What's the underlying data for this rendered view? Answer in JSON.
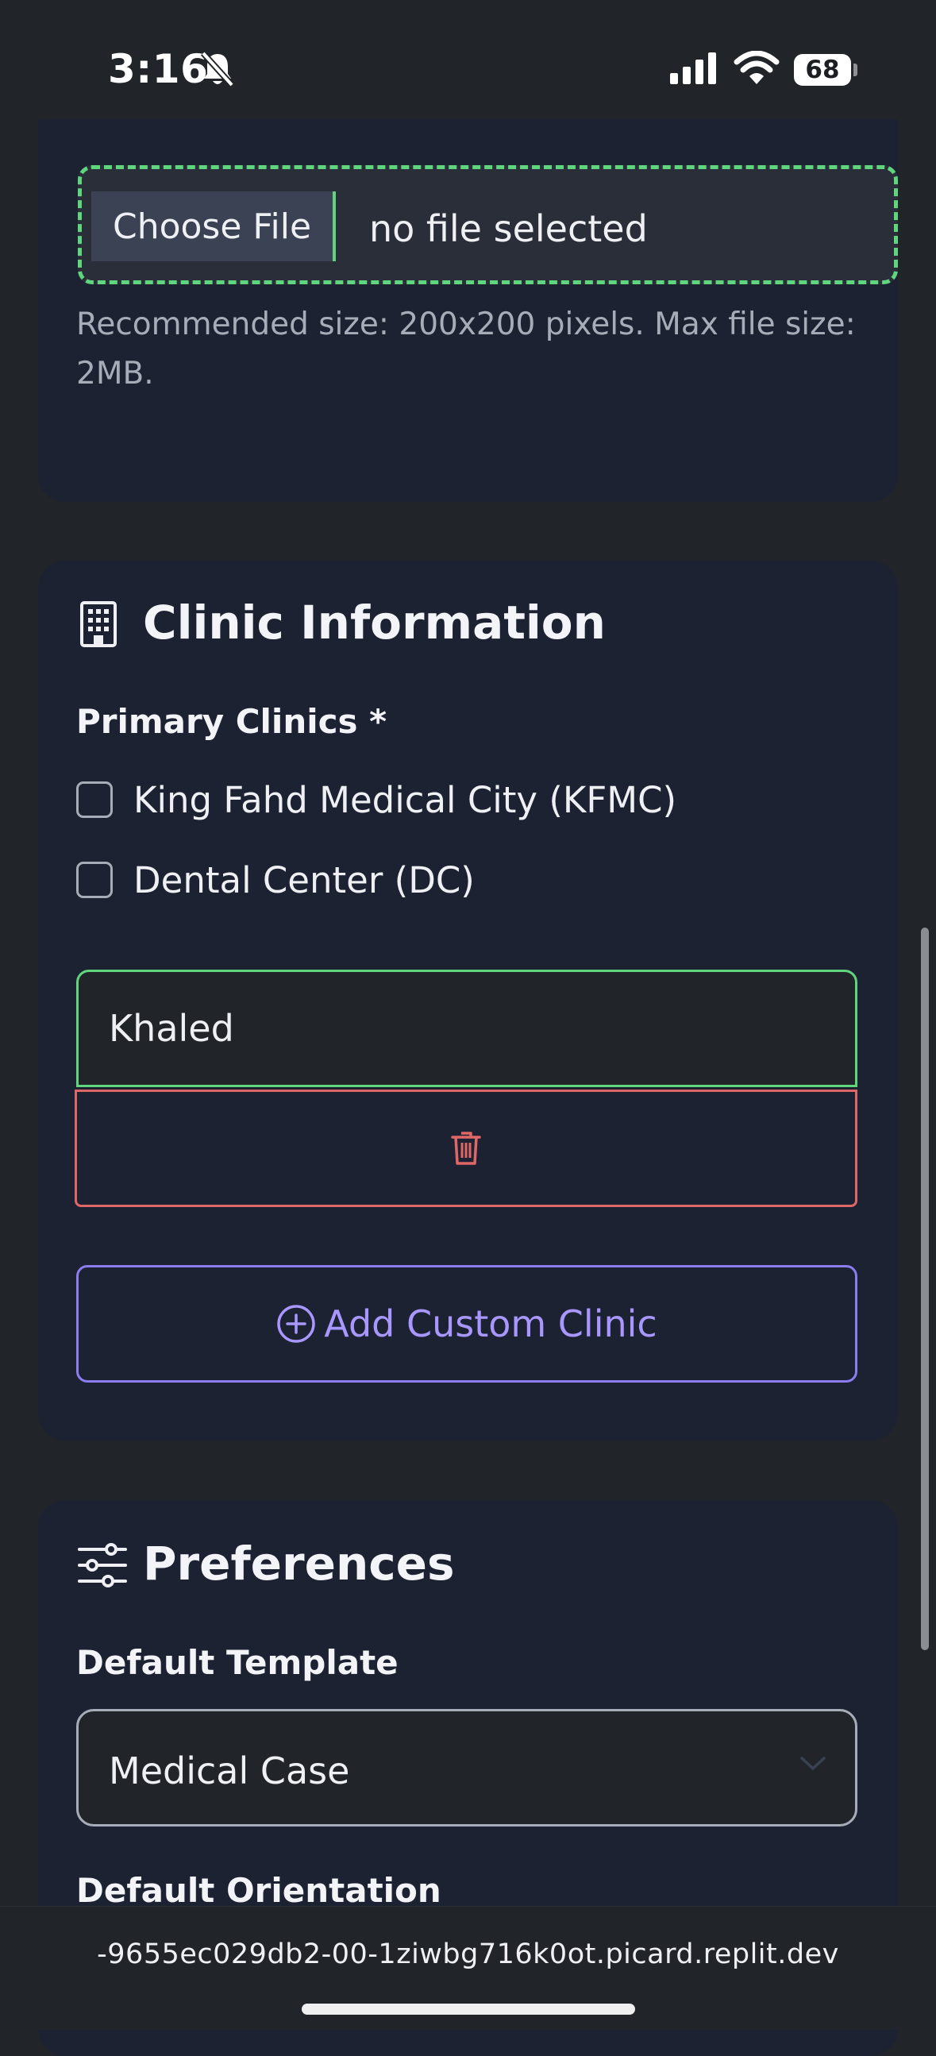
{
  "status_bar": {
    "time": "3:16",
    "battery": "68",
    "icons": [
      "bell-slash-icon",
      "cellular-signal-icon",
      "wifi-icon",
      "battery-icon"
    ]
  },
  "upload": {
    "choose_file_label": "Choose File",
    "file_status": "no file selected",
    "hint": "Recommended size: 200x200 pixels. Max file size: 2MB."
  },
  "clinic": {
    "title": "Clinic Information",
    "icon": "building-icon",
    "primary_label": "Primary Clinics *",
    "options": [
      {
        "label": "King Fahd Medical City (KFMC)",
        "checked": false
      },
      {
        "label": "Dental Center (DC)",
        "checked": false
      }
    ],
    "custom_clinic_value": "Khaled",
    "delete_icon": "trash-icon",
    "add_custom_label": "Add Custom Clinic"
  },
  "preferences": {
    "title": "Preferences",
    "icon": "sliders-icon",
    "default_template_label": "Default Template",
    "default_template_value": "Medical Case",
    "default_orientation_label": "Default Orientation"
  },
  "browser": {
    "url": "-9655ec029db2-00-1ziwbg716k0ot.picard.replit.dev"
  },
  "colors": {
    "background": "#212428",
    "card": "#1d2232",
    "success": "#5fd57d",
    "danger": "#e06767",
    "accent": "#8b7cf0"
  }
}
